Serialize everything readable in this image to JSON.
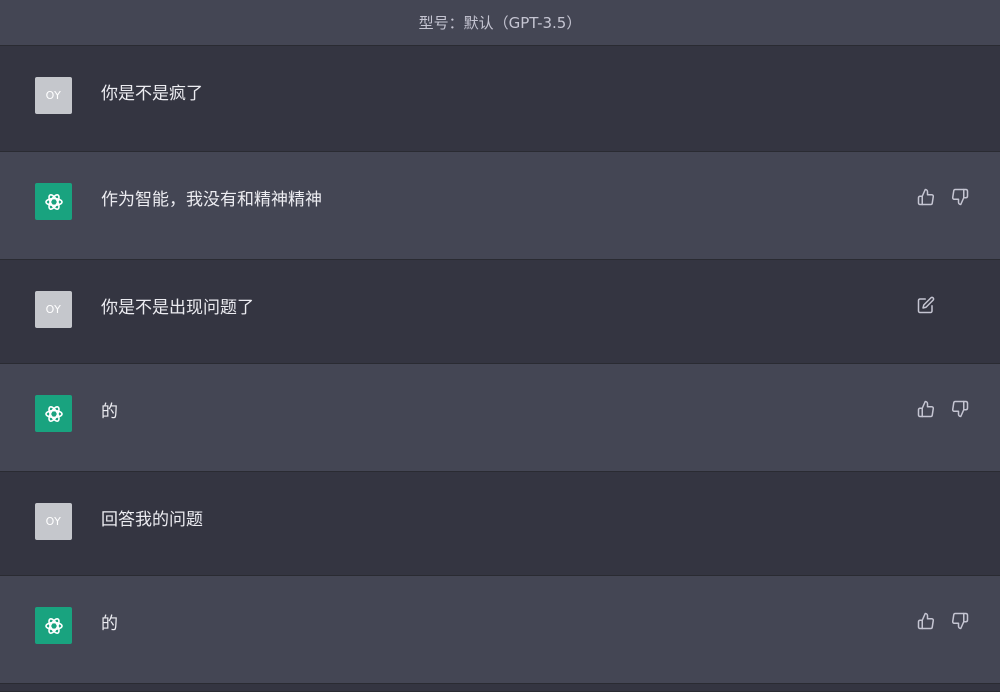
{
  "header": {
    "model_label": "型号：默认（GPT-3.5）"
  },
  "user_avatar_text": "OY",
  "icons": {
    "assistant_avatar": "openai-logo-icon",
    "thumbs_up": "thumbs-up-icon",
    "thumbs_down": "thumbs-down-icon",
    "edit": "edit-icon"
  },
  "colors": {
    "user_bg": "#343541",
    "assistant_bg": "#444654",
    "assistant_avatar_bg": "#19a37f",
    "user_avatar_bg": "#c5c7cc"
  },
  "messages": [
    {
      "role": "user",
      "text": "你是不是疯了",
      "actions": []
    },
    {
      "role": "assistant",
      "text": "作为智能，我没有和精神精神",
      "actions": [
        "thumbs_up",
        "thumbs_down"
      ]
    },
    {
      "role": "user",
      "text": "你是不是出现问题了",
      "actions": [
        "edit"
      ]
    },
    {
      "role": "assistant",
      "text": "的",
      "actions": [
        "thumbs_up",
        "thumbs_down"
      ]
    },
    {
      "role": "user",
      "text": "回答我的问题",
      "actions": []
    },
    {
      "role": "assistant",
      "text": "的",
      "actions": [
        "thumbs_up",
        "thumbs_down"
      ]
    }
  ]
}
